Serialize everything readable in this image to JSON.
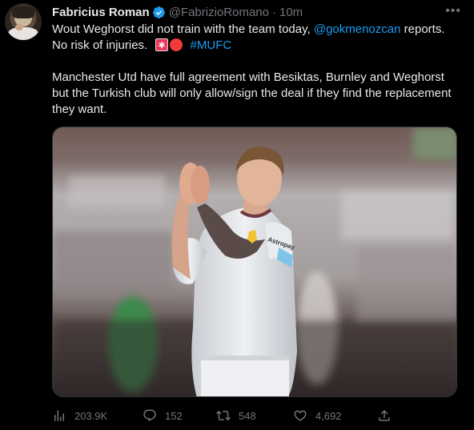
{
  "author": {
    "name": "Fabricius Roman",
    "handle": "@FabrizioRomano",
    "separator": "·",
    "time": "10m"
  },
  "tweet": {
    "line1_text": "Wout Weghorst did not train with the team today,",
    "line1_mention": "@gokmenozcan",
    "line1_suffix": "reports.",
    "line2_text": "No risk of injuries.",
    "hashtag": "#MUFC",
    "paragraph2": "Manchester Utd have full agreement with Besiktas, Burnley and Weghorst but the Turkish club will only allow/sign the deal if they find the replacement they want."
  },
  "media": {
    "sponsor_text": "Astropay"
  },
  "stats": {
    "views": "203.9K",
    "replies": "152",
    "retweets": "548",
    "likes": "4,692"
  },
  "icons": {
    "verified": "verified-badge-icon",
    "more": "more-icon",
    "views": "views-icon",
    "reply": "reply-icon",
    "retweet": "retweet-icon",
    "like": "like-icon",
    "share": "share-icon"
  },
  "colors": {
    "link": "#1d9bf0",
    "muted": "#71767b",
    "text": "#e7e9ea",
    "background": "#000000"
  }
}
